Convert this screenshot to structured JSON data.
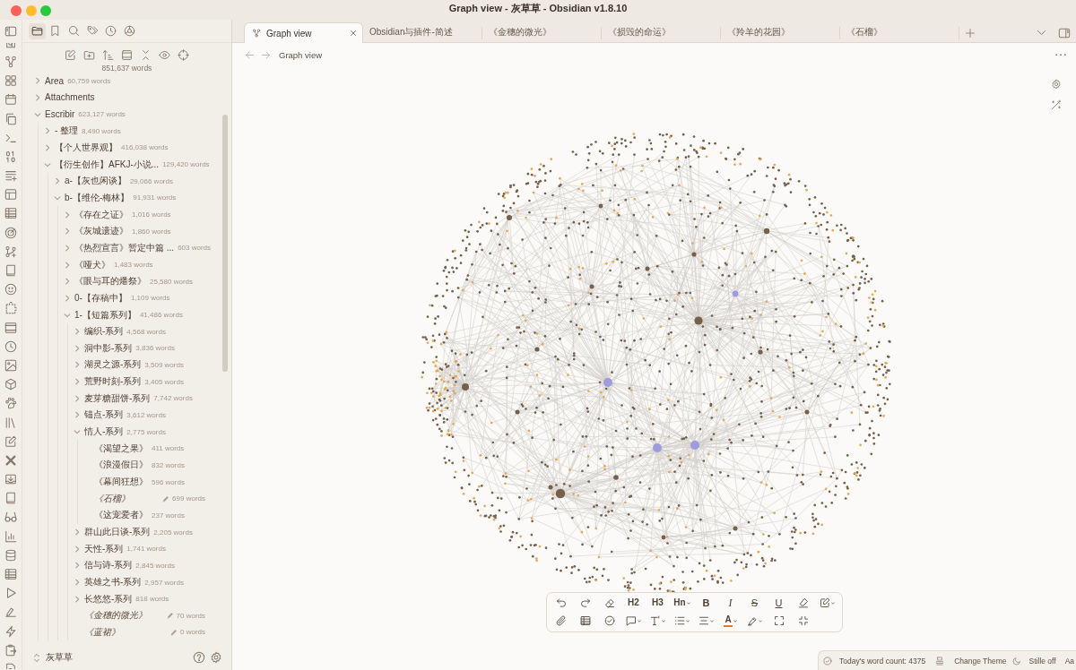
{
  "window": {
    "title": "Graph view - 灰草草 - Obsidian v1.8.10"
  },
  "sidebar_tabs": [
    {
      "kind": "files",
      "selected": true
    },
    {
      "kind": "bookmarks",
      "selected": false
    },
    {
      "kind": "search",
      "selected": false
    },
    {
      "kind": "tags",
      "selected": false
    },
    {
      "kind": "recent",
      "selected": false
    },
    {
      "kind": "compass",
      "selected": false
    }
  ],
  "file_tree": {
    "total": "851,637 words",
    "items": [
      {
        "kind": "folder",
        "name": "Area",
        "count": "60,759 words",
        "expanded": false
      },
      {
        "kind": "folder",
        "name": "Attachments",
        "expanded": false
      },
      {
        "kind": "folder",
        "name": "Escribir",
        "count": "623,127 words",
        "expanded": true,
        "children": [
          {
            "kind": "folder",
            "name": "- 整理",
            "count": "8,490 words",
            "expanded": false
          },
          {
            "kind": "folder",
            "name": "【个人世界观】",
            "count": "416,038 words",
            "expanded": false
          },
          {
            "kind": "folder",
            "name": "【衍生创作】AFKJ-小说...",
            "count": "129,420 words",
            "expanded": true,
            "children": [
              {
                "kind": "folder",
                "name": "a-【灰也闲谈】",
                "count": "29,066 words",
                "expanded": false
              },
              {
                "kind": "folder",
                "name": "b-【维伦-梅林】",
                "count": "91,931 words",
                "expanded": true,
                "children": [
                  {
                    "kind": "folder",
                    "name": "《存在之证》",
                    "count": "1,016 words",
                    "expanded": false
                  },
                  {
                    "kind": "folder",
                    "name": "《灰城遗迹》",
                    "count": "1,860 words",
                    "expanded": false
                  },
                  {
                    "kind": "folder",
                    "name": "《热烈宣言》暂定中篇 ...",
                    "count": "603 words",
                    "expanded": false
                  },
                  {
                    "kind": "folder",
                    "name": "《哑犬》",
                    "count": "1,483 words",
                    "expanded": false
                  },
                  {
                    "kind": "folder",
                    "name": "《眼与耳的燔祭》",
                    "count": "25,580 words",
                    "expanded": false
                  },
                  {
                    "kind": "folder",
                    "name": "0-【存稿中】",
                    "count": "1,109 words",
                    "expanded": false
                  },
                  {
                    "kind": "folder",
                    "name": "1-【短篇系列】",
                    "count": "41,486 words",
                    "expanded": true,
                    "children": [
                      {
                        "kind": "folder",
                        "name": "编织-系列",
                        "count": "4,568 words",
                        "expanded": false
                      },
                      {
                        "kind": "folder",
                        "name": "洞中影-系列",
                        "count": "3,836 words",
                        "expanded": false
                      },
                      {
                        "kind": "folder",
                        "name": "湖灵之源-系列",
                        "count": "3,509 words",
                        "expanded": false
                      },
                      {
                        "kind": "folder",
                        "name": "荒野时刻-系列",
                        "count": "3,405 words",
                        "expanded": false
                      },
                      {
                        "kind": "folder",
                        "name": "麦芽糖甜饼-系列",
                        "count": "7,742 words",
                        "expanded": false
                      },
                      {
                        "kind": "folder",
                        "name": "锚点-系列",
                        "count": "3,612 words",
                        "expanded": false
                      },
                      {
                        "kind": "folder",
                        "name": "情人-系列",
                        "count": "2,775 words",
                        "expanded": true,
                        "children": [
                          {
                            "kind": "file",
                            "name": "《渴望之果》",
                            "count": "411 words",
                            "edited": false
                          },
                          {
                            "kind": "file",
                            "name": "《浪漫假日》",
                            "count": "832 words",
                            "edited": false
                          },
                          {
                            "kind": "file",
                            "name": "《幕间狂想》",
                            "count": "596 words",
                            "edited": false
                          },
                          {
                            "kind": "file",
                            "name": "《石榴》",
                            "count": "699 words",
                            "edited": true
                          },
                          {
                            "kind": "file",
                            "name": "《这宠爱者》",
                            "count": "237 words",
                            "edited": false
                          }
                        ]
                      },
                      {
                        "kind": "folder",
                        "name": "群山此日谈-系列",
                        "count": "2,205 words",
                        "expanded": false
                      },
                      {
                        "kind": "folder",
                        "name": "天性-系列",
                        "count": "1,741 words",
                        "expanded": false
                      },
                      {
                        "kind": "folder",
                        "name": "信与诗-系列",
                        "count": "2,845 words",
                        "expanded": false
                      },
                      {
                        "kind": "folder",
                        "name": "英雄之书-系列",
                        "count": "2,957 words",
                        "expanded": false
                      },
                      {
                        "kind": "folder",
                        "name": "长悠悠-系列",
                        "count": "818 words",
                        "expanded": false
                      },
                      {
                        "kind": "file",
                        "name": "《金穗的微光》",
                        "count": "70 words",
                        "edited": true
                      },
                      {
                        "kind": "file",
                        "name": "《蓝裙》",
                        "count": "0 words",
                        "edited": true
                      }
                    ]
                  }
                ]
              }
            ]
          }
        ]
      }
    ]
  },
  "vault": {
    "name": "灰草草"
  },
  "tabs": [
    {
      "kind": "graph",
      "label": "Graph view",
      "selected": true
    },
    {
      "kind": "note",
      "label": "Obsidian与插件-简述",
      "selected": false
    },
    {
      "kind": "note",
      "label": "《金穗的微光》",
      "selected": false
    },
    {
      "kind": "note",
      "label": "《损毁的命运》",
      "selected": false
    },
    {
      "kind": "note",
      "label": "《羚羊的花园》",
      "selected": false
    },
    {
      "kind": "note",
      "label": "《石榴》",
      "selected": false
    }
  ],
  "view_header": {
    "title": "Graph view"
  },
  "editing_toolbar": {
    "rows": [
      [
        {
          "kind": "undo",
          "dropdown": false
        },
        {
          "kind": "redo",
          "dropdown": false
        },
        {
          "kind": "eraser",
          "dropdown": false
        },
        {
          "kind": "heading",
          "glyph": "H2",
          "dropdown": false
        },
        {
          "kind": "heading",
          "glyph": "H3",
          "dropdown": false
        },
        {
          "kind": "heading",
          "glyph": "Hn",
          "dropdown": true
        },
        {
          "kind": "bold",
          "glyph": "B",
          "dropdown": false
        },
        {
          "kind": "italic",
          "glyph": "I",
          "dropdown": false
        },
        {
          "kind": "strike",
          "glyph": "S",
          "dropdown": false
        },
        {
          "kind": "underline",
          "glyph": "U",
          "dropdown": false
        },
        {
          "kind": "brush",
          "dropdown": false
        },
        {
          "kind": "edit",
          "dropdown": true
        }
      ],
      [
        {
          "kind": "attach",
          "dropdown": false
        },
        {
          "kind": "table",
          "dropdown": false
        },
        {
          "kind": "check",
          "dropdown": false
        },
        {
          "kind": "comment",
          "dropdown": true
        },
        {
          "kind": "format",
          "dropdown": true
        },
        {
          "kind": "list",
          "dropdown": true
        },
        {
          "kind": "align",
          "dropdown": true
        },
        {
          "kind": "fontcolor",
          "glyph": "A",
          "color": "#e07b2e",
          "dropdown": true
        },
        {
          "kind": "highlight",
          "dropdown": true
        },
        {
          "kind": "fullscreen",
          "dropdown": false
        },
        {
          "kind": "shrink",
          "dropdown": false
        }
      ]
    ]
  },
  "status_bar": {
    "word_count": "Today's word count: 4375",
    "theme": "Change Theme",
    "focus": "Stille off",
    "font": "Aa"
  }
}
